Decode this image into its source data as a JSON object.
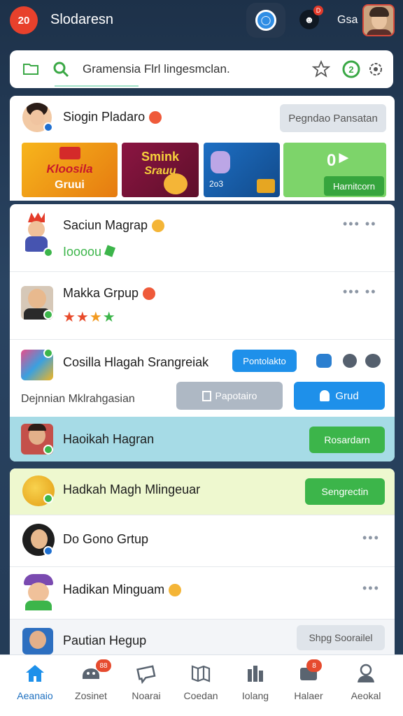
{
  "topbar": {
    "badge": "20",
    "title": "Slodaresn",
    "username": "Gsa",
    "message_badge": "D"
  },
  "search": {
    "placeholder": "Gramensia Flrl lingesmclan."
  },
  "featured": {
    "name": "Siogin Pladaro",
    "action": "Pegndao Pansatan",
    "tiles": [
      {
        "text_top": "Kloosila",
        "text_bottom": "Gruui"
      },
      {
        "text_top": "Smink",
        "text_bottom": "Srauu"
      },
      {
        "text_bottom": "2o3"
      },
      {
        "value": "0",
        "action": "Harnitcorn"
      }
    ]
  },
  "rows": [
    {
      "name": "Saciun Magrap",
      "sub": "Ioooou"
    },
    {
      "name": "Makka Grpup",
      "rating": 4
    },
    {
      "name": "Cosilla Hlagah Srangreiak",
      "pill": "Pontolakto",
      "sub": "Dejnnian Mklrahgasian",
      "btn_secondary": "Papotairo",
      "btn_primary": "Grud"
    },
    {
      "name": "Haoikah Hagran",
      "action": "Rosardarn"
    },
    {
      "name": "Hadkah Magh Mlingeuar",
      "action": "Sengrectin"
    },
    {
      "name": "Do Gono Grtup"
    },
    {
      "name": "Hadikan Minguam"
    },
    {
      "name": "Pautian Hegup",
      "action": "Shpg Soorailel"
    }
  ],
  "nav": [
    {
      "label": "Aeanaio",
      "icon": "home-icon",
      "active": true
    },
    {
      "label": "Zosinet",
      "icon": "group-icon",
      "badge": "88"
    },
    {
      "label": "Noarai",
      "icon": "chat-icon"
    },
    {
      "label": "Coedan",
      "icon": "map-icon"
    },
    {
      "label": "Iolang",
      "icon": "library-icon"
    },
    {
      "label": "Halaer",
      "icon": "inbox-icon",
      "badge": "8"
    },
    {
      "label": "Aeokal",
      "icon": "profile-icon"
    }
  ],
  "colors": {
    "accent_blue": "#1e90ea",
    "accent_green": "#3cb54a",
    "alert_red": "#e8412c"
  }
}
